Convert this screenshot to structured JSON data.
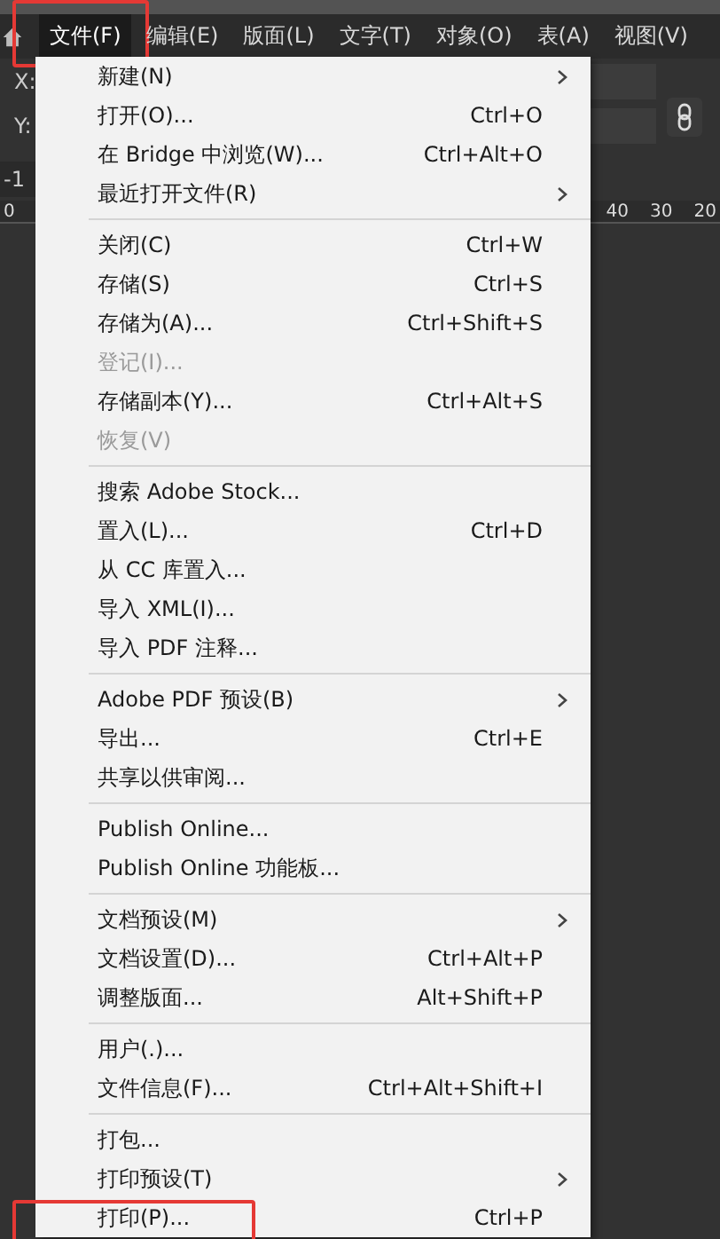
{
  "menubar": [
    {
      "label": "文件(F)",
      "selected": true,
      "highlighted": true
    },
    {
      "label": "编辑(E)",
      "selected": false,
      "highlighted": false
    },
    {
      "label": "版面(L)",
      "selected": false,
      "highlighted": false
    },
    {
      "label": "文字(T)",
      "selected": false,
      "highlighted": false
    },
    {
      "label": "对象(O)",
      "selected": false,
      "highlighted": false
    },
    {
      "label": "表(A)",
      "selected": false,
      "highlighted": false
    },
    {
      "label": "视图(V)",
      "selected": false,
      "highlighted": false
    }
  ],
  "control_panel": {
    "x_label": "X:",
    "y_label": "Y:"
  },
  "document_tab": {
    "label": "-1"
  },
  "ruler": {
    "left_labels": [
      "0"
    ],
    "right_labels": [
      "40",
      "30",
      "20"
    ]
  },
  "file_menu": {
    "groups": [
      [
        {
          "label": "新建(N)",
          "submenu": true,
          "disabled": false,
          "highlighted": false
        },
        {
          "label": "打开(O)...",
          "shortcut": "Ctrl+O",
          "submenu": false,
          "disabled": false,
          "highlighted": false
        },
        {
          "label": "在 Bridge 中浏览(W)...",
          "shortcut": "Ctrl+Alt+O",
          "submenu": false,
          "disabled": false,
          "highlighted": false
        },
        {
          "label": "最近打开文件(R)",
          "submenu": true,
          "disabled": false,
          "highlighted": false
        }
      ],
      [
        {
          "label": "关闭(C)",
          "shortcut": "Ctrl+W",
          "submenu": false,
          "disabled": false,
          "highlighted": false
        },
        {
          "label": "存储(S)",
          "shortcut": "Ctrl+S",
          "submenu": false,
          "disabled": false,
          "highlighted": false
        },
        {
          "label": "存储为(A)...",
          "shortcut": "Ctrl+Shift+S",
          "submenu": false,
          "disabled": false,
          "highlighted": false
        },
        {
          "label": "登记(I)...",
          "submenu": false,
          "disabled": true,
          "highlighted": false
        },
        {
          "label": "存储副本(Y)...",
          "shortcut": "Ctrl+Alt+S",
          "submenu": false,
          "disabled": false,
          "highlighted": false
        },
        {
          "label": "恢复(V)",
          "submenu": false,
          "disabled": true,
          "highlighted": false
        }
      ],
      [
        {
          "label": "搜索 Adobe Stock...",
          "submenu": false,
          "disabled": false,
          "highlighted": false
        },
        {
          "label": "置入(L)...",
          "shortcut": "Ctrl+D",
          "submenu": false,
          "disabled": false,
          "highlighted": false
        },
        {
          "label": "从 CC 库置入...",
          "submenu": false,
          "disabled": false,
          "highlighted": false
        },
        {
          "label": "导入 XML(I)...",
          "submenu": false,
          "disabled": false,
          "highlighted": false
        },
        {
          "label": "导入 PDF 注释...",
          "submenu": false,
          "disabled": false,
          "highlighted": false
        }
      ],
      [
        {
          "label": "Adobe PDF 预设(B)",
          "submenu": true,
          "disabled": false,
          "highlighted": false
        },
        {
          "label": "导出...",
          "shortcut": "Ctrl+E",
          "submenu": false,
          "disabled": false,
          "highlighted": false
        },
        {
          "label": "共享以供审阅...",
          "submenu": false,
          "disabled": false,
          "highlighted": false
        }
      ],
      [
        {
          "label": "Publish Online...",
          "submenu": false,
          "disabled": false,
          "highlighted": false
        },
        {
          "label": "Publish Online 功能板...",
          "submenu": false,
          "disabled": false,
          "highlighted": false
        }
      ],
      [
        {
          "label": "文档预设(M)",
          "submenu": true,
          "disabled": false,
          "highlighted": false
        },
        {
          "label": "文档设置(D)...",
          "shortcut": "Ctrl+Alt+P",
          "submenu": false,
          "disabled": false,
          "highlighted": false
        },
        {
          "label": "调整版面...",
          "shortcut": "Alt+Shift+P",
          "submenu": false,
          "disabled": false,
          "highlighted": false
        }
      ],
      [
        {
          "label": "用户(.)...",
          "submenu": false,
          "disabled": false,
          "highlighted": false
        },
        {
          "label": "文件信息(F)...",
          "shortcut": "Ctrl+Alt+Shift+I",
          "submenu": false,
          "disabled": false,
          "highlighted": false
        }
      ],
      [
        {
          "label": "打包...",
          "submenu": false,
          "disabled": false,
          "highlighted": false
        },
        {
          "label": "打印预设(T)",
          "submenu": true,
          "disabled": false,
          "highlighted": false
        },
        {
          "label": "打印(P)...",
          "shortcut": "Ctrl+P",
          "submenu": false,
          "disabled": false,
          "highlighted": true
        }
      ]
    ]
  }
}
